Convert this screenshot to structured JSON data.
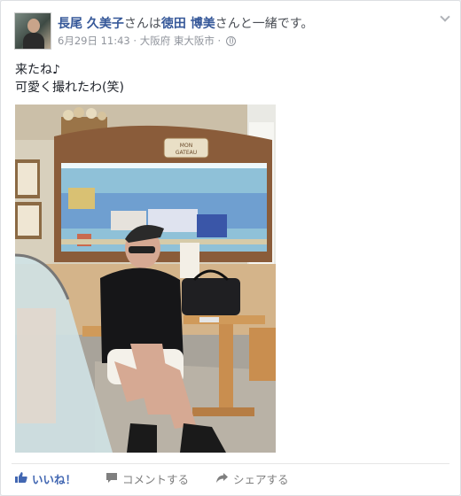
{
  "post": {
    "author": "長尾 久美子",
    "with_text_pre": "さんは",
    "tagged": "徳田 博美",
    "with_text_post": "さんと一緒です。",
    "date": "6月29日 11:43",
    "separator": " · ",
    "location": "大阪府 東大阪市",
    "separator2": " · ",
    "text_line1": "来たね♪",
    "text_line2": "可愛く撮れたわ(笑)"
  },
  "photo": {
    "sign_text1": "MON",
    "sign_text2": "GATEAU"
  },
  "actions": {
    "like": "いいね！",
    "comment": "コメントする",
    "share": "シェアする"
  },
  "colors": {
    "link": "#365899",
    "like": "#4267b2",
    "meta": "#90949c"
  }
}
